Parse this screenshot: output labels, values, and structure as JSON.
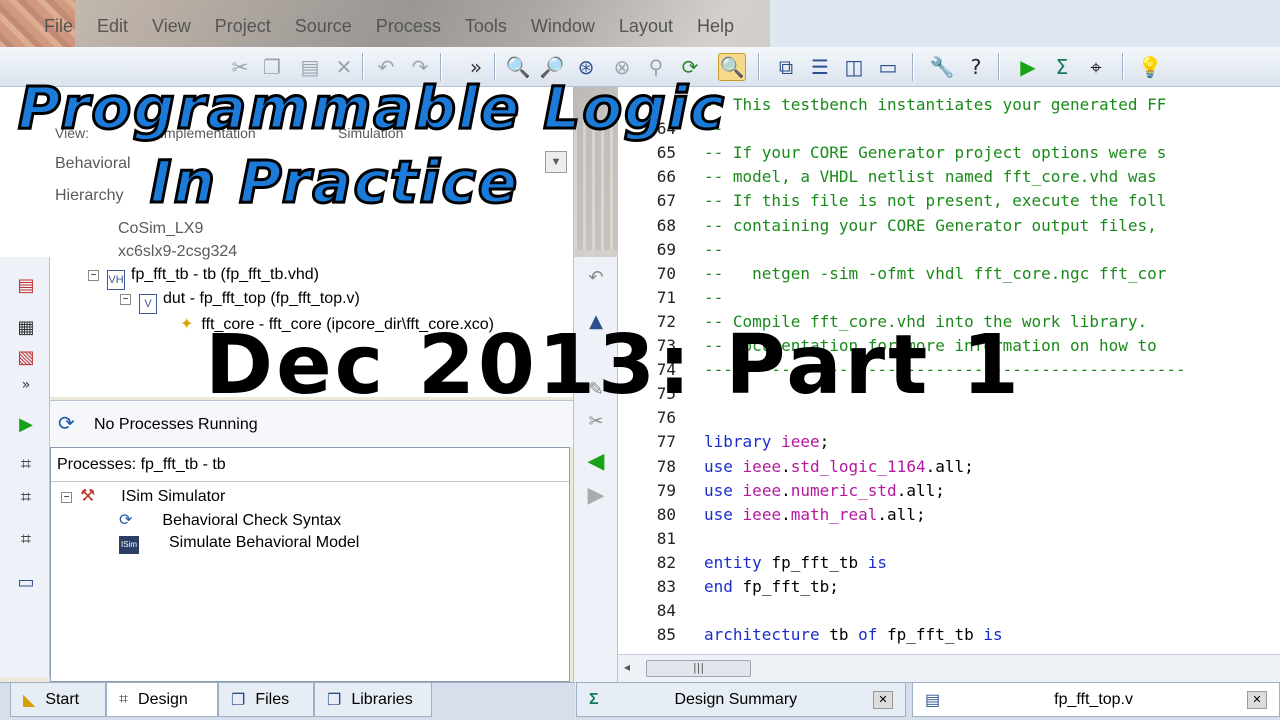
{
  "menu": [
    "File",
    "Edit",
    "View",
    "Project",
    "Source",
    "Process",
    "Tools",
    "Window",
    "Layout",
    "Help"
  ],
  "overlay": {
    "title_line1": "Programmable Logic",
    "title_line2": "In Practice",
    "subtitle": "Dec 2013: Part 1"
  },
  "hierarchy_panel": {
    "view_label": "View:",
    "implementation_label": "Implementation",
    "simulation_label": "Simulation",
    "mode_value": "Behavioral",
    "hierarchy_label": "Hierarchy",
    "project": "CoSim_LX9",
    "device": "xc6slx9-2csg324",
    "tb_node": "fp_fft_tb - tb (fp_fft_tb.vhd)",
    "dut_node": "dut - fp_fft_top (fp_fft_top.v)",
    "core_node": "fft_core - fft_core (ipcore_dir\\fft_core.xco)"
  },
  "processes": {
    "status": "No Processes Running",
    "title": "Processes: fp_fft_tb - tb",
    "group": "ISim Simulator",
    "items": [
      "Behavioral Check Syntax",
      "Simulate Behavioral Model"
    ]
  },
  "left_tabs": [
    "Start",
    "Design",
    "Files",
    "Libraries"
  ],
  "editor_tabs": [
    "Design Summary",
    "fp_fft_top.v"
  ],
  "editor_lines": [
    {
      "n": "",
      "t": "-- This testbench instantiates your generated FF",
      "c": "cmt"
    },
    {
      "n": "64",
      "t": "--",
      "c": "cmt"
    },
    {
      "n": "65",
      "t": "-- If your CORE Generator project options were s",
      "c": "cmt"
    },
    {
      "n": "66",
      "t": "-- model, a VHDL netlist named fft_core.vhd was",
      "c": "cmt"
    },
    {
      "n": "67",
      "t": "-- If this file is not present, execute the foll",
      "c": "cmt"
    },
    {
      "n": "68",
      "t": "-- containing your CORE Generator output files,",
      "c": "cmt"
    },
    {
      "n": "69",
      "t": "--",
      "c": "cmt"
    },
    {
      "n": "70",
      "t": "--   netgen -sim -ofmt vhdl fft_core.ngc fft_cor",
      "c": "cmt"
    },
    {
      "n": "71",
      "t": "--",
      "c": "cmt"
    },
    {
      "n": "72",
      "t": "-- Compile fft_core.vhd into the work library.",
      "c": "cmt"
    },
    {
      "n": "73",
      "t": "-- documentation for more information on how to",
      "c": "cmt"
    },
    {
      "n": "74",
      "t": "--------------------------------------------------",
      "c": "cmt"
    },
    {
      "n": "75",
      "t": "",
      "c": ""
    },
    {
      "n": "76",
      "t": "",
      "c": ""
    },
    {
      "n": "77",
      "t": "library ieee;",
      "c": "mix1"
    },
    {
      "n": "78",
      "t": "use ieee.std_logic_1164.all;",
      "c": "mix2"
    },
    {
      "n": "79",
      "t": "use ieee.numeric_std.all;",
      "c": "mix2"
    },
    {
      "n": "80",
      "t": "use ieee.math_real.all;",
      "c": "mix2"
    },
    {
      "n": "81",
      "t": "",
      "c": ""
    },
    {
      "n": "82",
      "t": "entity fp_fft_tb is",
      "c": "mix3"
    },
    {
      "n": "83",
      "t": "end fp_fft_tb;",
      "c": "mix4"
    },
    {
      "n": "84",
      "t": "",
      "c": ""
    },
    {
      "n": "85",
      "t": "architecture tb of fp_fft_tb is",
      "c": "mix5"
    }
  ]
}
